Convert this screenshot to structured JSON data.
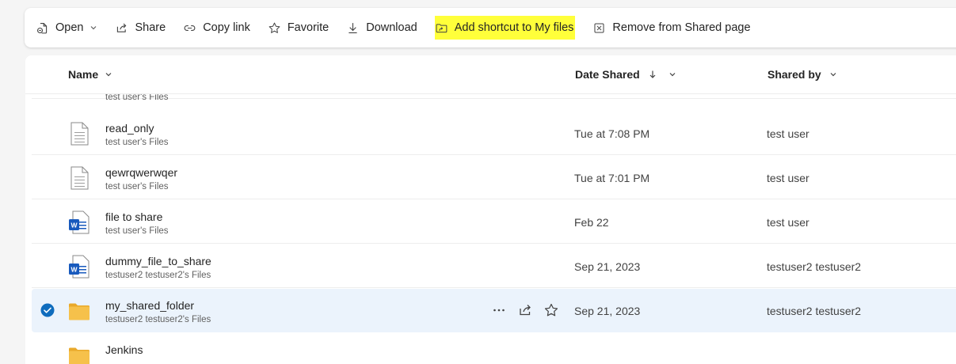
{
  "toolbar": {
    "open": "Open",
    "share": "Share",
    "copy_link": "Copy link",
    "favorite": "Favorite",
    "download": "Download",
    "add_shortcut": "Add shortcut to My files",
    "remove": "Remove from Shared page"
  },
  "columns": {
    "name": "Name",
    "date_shared": "Date Shared",
    "shared_by": "Shared by"
  },
  "colors": {
    "accent": "#0f6cbd",
    "highlight": "#ffff3a",
    "selected_row": "#ebf3fc",
    "folder": "#f6c14b",
    "word": "#185abd"
  },
  "rows": [
    {
      "icon": "word-doc-icon",
      "name": "",
      "location": "test user's Files",
      "date": "",
      "shared_by": ""
    },
    {
      "icon": "text-file-icon",
      "name": "read_only",
      "location": "test user's Files",
      "date": "Tue at 7:08 PM",
      "shared_by": "test user"
    },
    {
      "icon": "text-file-icon",
      "name": "qewrqwerwqer",
      "location": "test user's Files",
      "date": "Tue at 7:01 PM",
      "shared_by": "test user"
    },
    {
      "icon": "word-doc-icon",
      "name": "file to share",
      "location": "test user's Files",
      "date": "Feb 22",
      "shared_by": "test user"
    },
    {
      "icon": "word-doc-icon",
      "name": "dummy_file_to_share",
      "location": "testuser2 testuser2's Files",
      "date": "Sep 21, 2023",
      "shared_by": "testuser2 testuser2"
    },
    {
      "icon": "folder-icon",
      "name": "my_shared_folder",
      "location": "testuser2 testuser2's Files",
      "date": "Sep 21, 2023",
      "shared_by": "testuser2 testuser2",
      "selected": true
    },
    {
      "icon": "folder-icon",
      "name": "Jenkins",
      "location": "",
      "date": "",
      "shared_by": ""
    }
  ]
}
